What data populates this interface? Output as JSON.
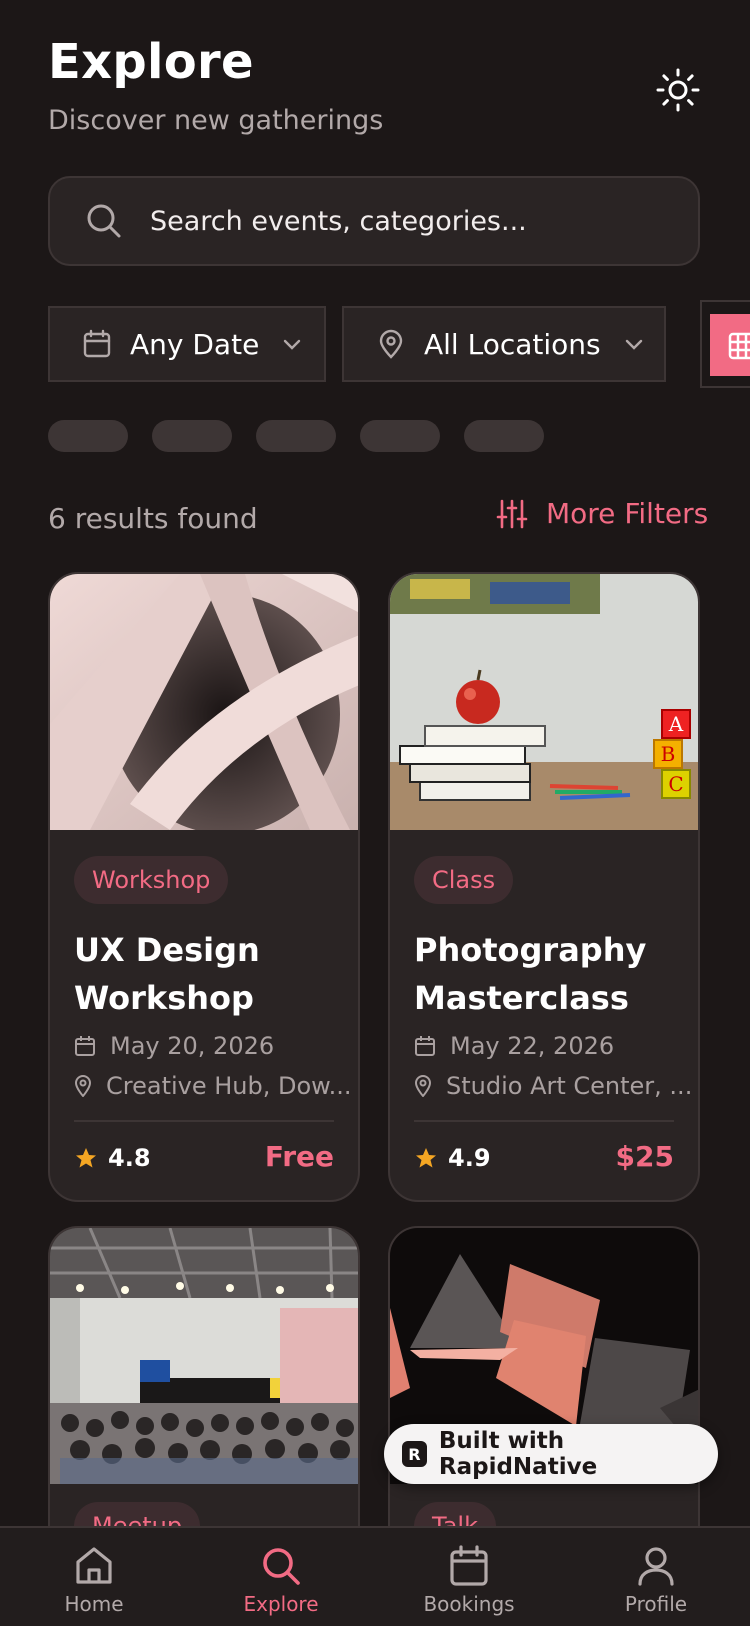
{
  "header": {
    "title": "Explore",
    "subtitle": "Discover new gatherings",
    "theme_icon": "sun-icon"
  },
  "search": {
    "placeholder": "Search events, categories..."
  },
  "filters": {
    "date_label": "Any Date",
    "location_label": "All Locations"
  },
  "results": {
    "count_text": "6 results found",
    "more_filters_label": "More Filters"
  },
  "events": [
    {
      "category": "Workshop",
      "title": "UX Design Workshop",
      "date": "May 20, 2026",
      "location": "Creative Hub, Dow...",
      "rating": "4.8",
      "price": "Free"
    },
    {
      "category": "Class",
      "title": "Photography Masterclass",
      "date": "May 22, 2026",
      "location": "Studio Art Center, ...",
      "rating": "4.9",
      "price": "$25"
    },
    {
      "category": "Meetup"
    },
    {
      "category": "Talk"
    }
  ],
  "built_with": "Built with RapidNative",
  "tabs": [
    {
      "label": "Home",
      "icon": "home-icon"
    },
    {
      "label": "Explore",
      "icon": "search-icon",
      "active": true
    },
    {
      "label": "Bookings",
      "icon": "calendar-icon"
    },
    {
      "label": "Profile",
      "icon": "user-icon"
    }
  ],
  "colors": {
    "background": "#1c1717",
    "surface": "#2a2424",
    "accent": "#f26b84",
    "star": "#f5a623"
  }
}
